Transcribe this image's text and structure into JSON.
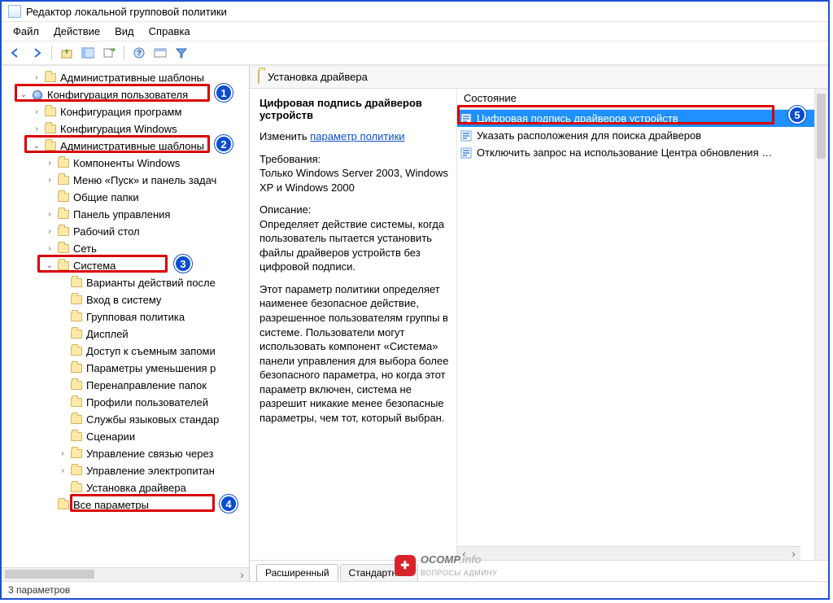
{
  "window": {
    "title": "Редактор локальной групповой политики"
  },
  "menu": {
    "file": "Файл",
    "action": "Действие",
    "view": "Вид",
    "help": "Справка"
  },
  "tree": {
    "admin_templates_top": "Административные шаблоны",
    "user_config": "Конфигурация пользователя",
    "prog_config": "Конфигурация программ",
    "win_config": "Конфигурация Windows",
    "admin_templates": "Административные шаблоны",
    "win_components": "Компоненты Windows",
    "start_menu": "Меню «Пуск» и панель задач",
    "shared_folders": "Общие папки",
    "control_panel": "Панель управления",
    "desktop": "Рабочий стол",
    "network": "Сеть",
    "system": "Система",
    "action_variants": "Варианты действий после",
    "logon": "Вход в систему",
    "group_policy": "Групповая политика",
    "display": "Дисплей",
    "removable": "Доступ к съемным запоми",
    "scaling": "Параметры уменьшения р",
    "folder_redirect": "Перенаправление папок",
    "user_profiles": "Профили пользователей",
    "lang_services": "Службы языковых стандар",
    "scripts": "Сценарии",
    "comm_mgmt": "Управление связью через",
    "power_mgmt": "Управление электропитан",
    "driver_install": "Установка драйвера",
    "all_params": "Все параметры"
  },
  "right": {
    "header": "Установка драйвера",
    "policy_title": "Цифровая подпись драйверов устройств",
    "edit_label": "Изменить",
    "edit_link": "параметр политики",
    "req_label": "Требования:",
    "req_text": "Только Windows Server 2003, Windows XP и Windows 2000",
    "desc_label": "Описание:",
    "desc_p1": "Определяет действие системы, когда пользователь пытается установить файлы драйверов устройств без цифровой подписи.",
    "desc_p2": "Этот параметр политики определяет наименее безопасное действие, разрешенное пользователям группы в системе. Пользователи могут использовать компонент «Система» панели управления для выбора более безопасного параметра, но когда этот параметр включен, система не разрешит никакие менее безопасные параметры, чем тот, который выбран.",
    "grid_header": "Состояние",
    "grid_items": [
      "Цифровая подпись драйверов устройств",
      "Указать расположения для поиска драйверов",
      "Отключить запрос на использование Центра обновления …"
    ],
    "tab_ext": "Расширенный",
    "tab_std": "Стандартный"
  },
  "status": "3 параметров",
  "watermark": {
    "brand": "OCOMP",
    "tld": ".info",
    "sub": "ВОПРОСЫ АДМИНУ"
  },
  "annotations": {
    "1": "1",
    "2": "2",
    "3": "3",
    "4": "4",
    "5": "5"
  }
}
